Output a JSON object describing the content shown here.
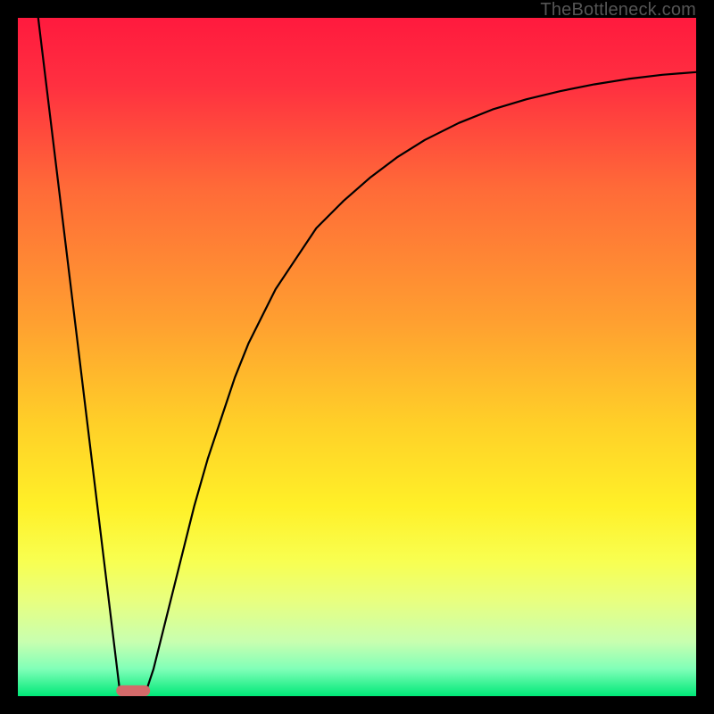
{
  "watermark": "TheBottleneck.com",
  "chart_data": {
    "type": "line",
    "title": "",
    "xlabel": "",
    "ylabel": "",
    "xlim": [
      0,
      100
    ],
    "ylim": [
      0,
      100
    ],
    "grid": false,
    "background": {
      "type": "vertical-gradient",
      "stops": [
        {
          "pos": 0.0,
          "color": "#ff1a3e"
        },
        {
          "pos": 0.1,
          "color": "#ff3040"
        },
        {
          "pos": 0.25,
          "color": "#ff6a38"
        },
        {
          "pos": 0.45,
          "color": "#ffa030"
        },
        {
          "pos": 0.6,
          "color": "#ffd028"
        },
        {
          "pos": 0.72,
          "color": "#fff028"
        },
        {
          "pos": 0.8,
          "color": "#f8ff50"
        },
        {
          "pos": 0.86,
          "color": "#e8ff80"
        },
        {
          "pos": 0.92,
          "color": "#c8ffb0"
        },
        {
          "pos": 0.96,
          "color": "#80ffb8"
        },
        {
          "pos": 1.0,
          "color": "#00e878"
        }
      ]
    },
    "series": [
      {
        "name": "left-edge",
        "type": "line",
        "color": "#000000",
        "width": 2.2,
        "x": [
          3,
          15
        ],
        "y": [
          100,
          1
        ]
      },
      {
        "name": "right-curve",
        "type": "line",
        "color": "#000000",
        "width": 2.2,
        "x": [
          19,
          20,
          22,
          24,
          26,
          28,
          30,
          32,
          34,
          36,
          38,
          40,
          44,
          48,
          52,
          56,
          60,
          65,
          70,
          75,
          80,
          85,
          90,
          95,
          100
        ],
        "y": [
          1,
          4,
          12,
          20,
          28,
          35,
          41,
          47,
          52,
          56,
          60,
          63,
          69,
          73,
          76.5,
          79.5,
          82,
          84.5,
          86.5,
          88,
          89.2,
          90.2,
          91,
          91.6,
          92
        ]
      }
    ],
    "minimum_marker": {
      "shape": "rounded-rect",
      "color": "#d46a6a",
      "x_center": 17,
      "y_center": 0.8,
      "width": 5,
      "height": 1.6
    }
  }
}
